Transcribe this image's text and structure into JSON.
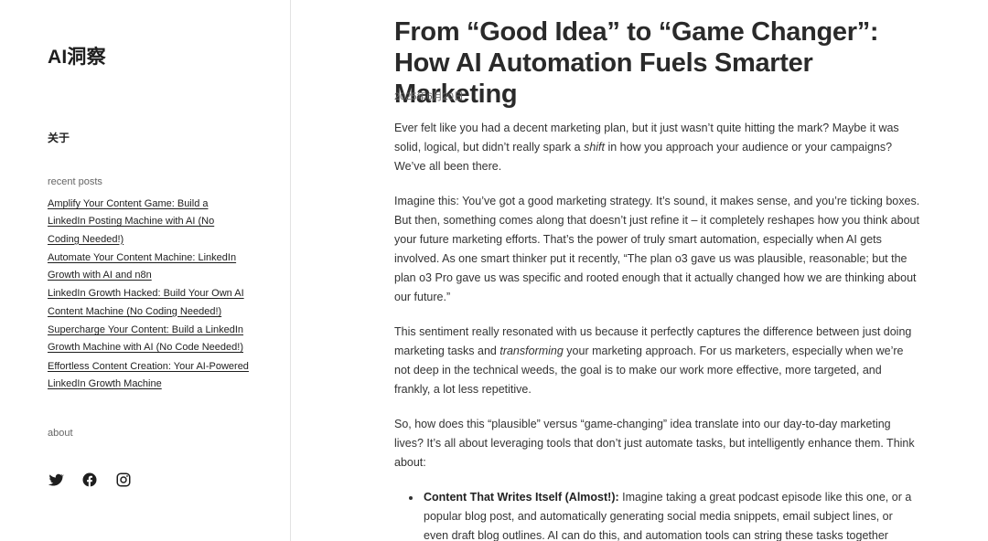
{
  "site": {
    "title": "AI洞察"
  },
  "nav": {
    "about_link": "关于"
  },
  "sidebar": {
    "recent_heading": "recent posts",
    "recent_posts": [
      "Amplify Your Content Game: Build a LinkedIn Posting Machine with AI (No Coding Needed!)",
      "Automate Your Content Machine: LinkedIn Growth with AI and n8n",
      "LinkedIn Growth Hacked: Build Your Own AI Content Machine (No Coding Needed!)",
      "Supercharge Your Content: Build a LinkedIn Growth Machine with AI (No Code Needed!)",
      "Effortless Content Creation: Your AI-Powered LinkedIn Growth Machine"
    ],
    "about_heading": "about",
    "social_icons": [
      "twitter-icon",
      "facebook-icon",
      "instagram-icon"
    ]
  },
  "post": {
    "title": "From “Good Idea” to “Game Changer”: How AI Automation Fuels Smarter Marketing",
    "date": "2025年6月20日",
    "p1": {
      "before": "Ever felt like you had a decent marketing plan, but it just wasn’t quite hitting the mark? Maybe it was solid, logical, but didn’t really spark a ",
      "em": "shift",
      "after": " in how you approach your audience or your campaigns? We’ve all been there."
    },
    "p2": "Imagine this: You’ve got a good marketing strategy. It’s sound, it makes sense, and you’re ticking boxes. But then, something comes along that doesn’t just refine it – it completely reshapes how you think about your future marketing efforts. That’s the power of truly smart automation, especially when AI gets involved. As one smart thinker put it recently, “The plan o3 gave us was plausible, reasonable; but the plan o3 Pro gave us was specific and rooted enough that it actually changed how we are thinking about our future.”",
    "p3": {
      "before": "This sentiment really resonated with us because it perfectly captures the difference between just doing marketing tasks and ",
      "em": "transforming",
      "after": " your marketing approach. For us marketers, especially when we’re not deep in the technical weeds, the goal is to make our work more effective, more targeted, and frankly, a lot less repetitive."
    },
    "p4": "So, how does this “plausible” versus “game-changing” idea translate into our day-to-day marketing lives? It’s all about leveraging tools that don’t just automate tasks, but intelligently enhance them. Think about:",
    "bullet1": {
      "strong": "Content That Writes Itself (Almost!):",
      "text": " Imagine taking a great podcast episode like this one, or a popular blog post, and automatically generating social media snippets, email subject lines, or even draft blog outlines. AI can do this, and automation tools can string these tasks together"
    }
  }
}
